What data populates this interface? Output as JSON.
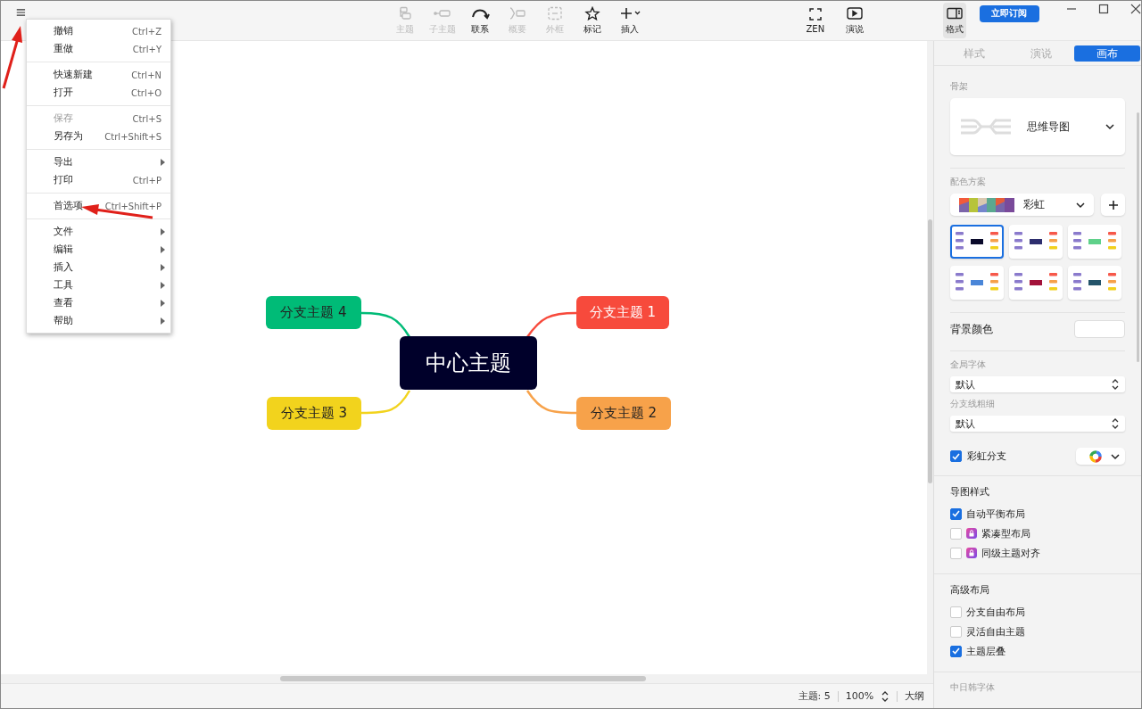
{
  "toolbar": {
    "items": [
      {
        "label": "主题",
        "kind": "topic",
        "disabled": true
      },
      {
        "label": "子主题",
        "kind": "subtopic",
        "disabled": true
      },
      {
        "label": "联系",
        "kind": "relation",
        "disabled": false
      },
      {
        "label": "概要",
        "kind": "summary",
        "disabled": true
      },
      {
        "label": "外框",
        "kind": "boundary",
        "disabled": true
      },
      {
        "label": "标记",
        "kind": "marker",
        "disabled": false
      },
      {
        "label": "插入",
        "kind": "insert",
        "disabled": false
      }
    ],
    "right_items": [
      {
        "label": "ZEN",
        "kind": "zen"
      },
      {
        "label": "演说",
        "kind": "pitch"
      }
    ],
    "format": {
      "label": "格式",
      "selected": true
    },
    "subscribe": "立即订阅"
  },
  "menu": {
    "groups": [
      [
        {
          "label": "撤销",
          "shortcut": "Ctrl+Z",
          "disabled": false,
          "submenu": false
        },
        {
          "label": "重做",
          "shortcut": "Ctrl+Y",
          "disabled": false,
          "submenu": false
        }
      ],
      [
        {
          "label": "快速新建",
          "shortcut": "Ctrl+N",
          "disabled": false,
          "submenu": false
        },
        {
          "label": "打开",
          "shortcut": "Ctrl+O",
          "disabled": false,
          "submenu": false
        }
      ],
      [
        {
          "label": "保存",
          "shortcut": "Ctrl+S",
          "disabled": true,
          "submenu": false
        },
        {
          "label": "另存为",
          "shortcut": "Ctrl+Shift+S",
          "disabled": false,
          "submenu": false
        }
      ],
      [
        {
          "label": "导出",
          "disabled": false,
          "submenu": true
        },
        {
          "label": "打印",
          "shortcut": "Ctrl+P",
          "disabled": false,
          "submenu": false
        }
      ],
      [
        {
          "label": "首选项",
          "shortcut": "Ctrl+Shift+P",
          "disabled": false,
          "submenu": false
        }
      ],
      [
        {
          "label": "文件",
          "disabled": false,
          "submenu": true
        },
        {
          "label": "编辑",
          "disabled": false,
          "submenu": true
        },
        {
          "label": "插入",
          "disabled": false,
          "submenu": true
        },
        {
          "label": "工具",
          "disabled": false,
          "submenu": true
        },
        {
          "label": "查看",
          "disabled": false,
          "submenu": true
        },
        {
          "label": "帮助",
          "disabled": false,
          "submenu": true
        }
      ]
    ]
  },
  "mindmap": {
    "center": "中心主题",
    "branches": [
      {
        "label": "分支主题 4",
        "color": "#00bb77"
      },
      {
        "label": "分支主题 1",
        "color": "#f74a3c"
      },
      {
        "label": "分支主题 3",
        "color": "#f2d31d"
      },
      {
        "label": "分支主题 2",
        "color": "#f7a24a"
      }
    ]
  },
  "panel": {
    "tabs": [
      {
        "label": "样式",
        "selected": false
      },
      {
        "label": "演说",
        "selected": false
      },
      {
        "label": "画布",
        "selected": true
      }
    ],
    "skeleton": {
      "label": "骨架",
      "value": "思维导图"
    },
    "color_scheme": {
      "label": "配色方案",
      "value": "彩虹",
      "themes": [
        {
          "color": "#0a0a2a",
          "selected": true
        },
        {
          "color": "#2d2e6e",
          "selected": false
        },
        {
          "color": "#5fd18a",
          "selected": false
        },
        {
          "color": "#4a86d8",
          "selected": false
        },
        {
          "color": "#a3123a",
          "selected": false
        },
        {
          "color": "#24546a",
          "selected": false
        }
      ]
    },
    "background": {
      "label": "背景颜色"
    },
    "global_font": {
      "label": "全局字体",
      "value": "默认"
    },
    "branch_width": {
      "label": "分支线粗细",
      "value": "默认"
    },
    "rainbow": {
      "label": "彩虹分支",
      "checked": true
    },
    "sections": [
      {
        "title": "导图样式",
        "options": [
          {
            "label": "自动平衡布局",
            "checked": true,
            "locked": false
          },
          {
            "label": "紧凑型布局",
            "checked": false,
            "locked": true
          },
          {
            "label": "同级主题对齐",
            "checked": false,
            "locked": true
          }
        ]
      },
      {
        "title": "高级布局",
        "options": [
          {
            "label": "分支自由布局",
            "checked": false,
            "locked": false
          },
          {
            "label": "灵活自由主题",
            "checked": false,
            "locked": false
          },
          {
            "label": "主题层叠",
            "checked": true,
            "locked": false
          }
        ]
      }
    ],
    "cjk_font": {
      "label": "中日韩字体"
    }
  },
  "status_bar": {
    "topics": "主题: 5",
    "zoom": "100%",
    "outline": "大纲"
  }
}
